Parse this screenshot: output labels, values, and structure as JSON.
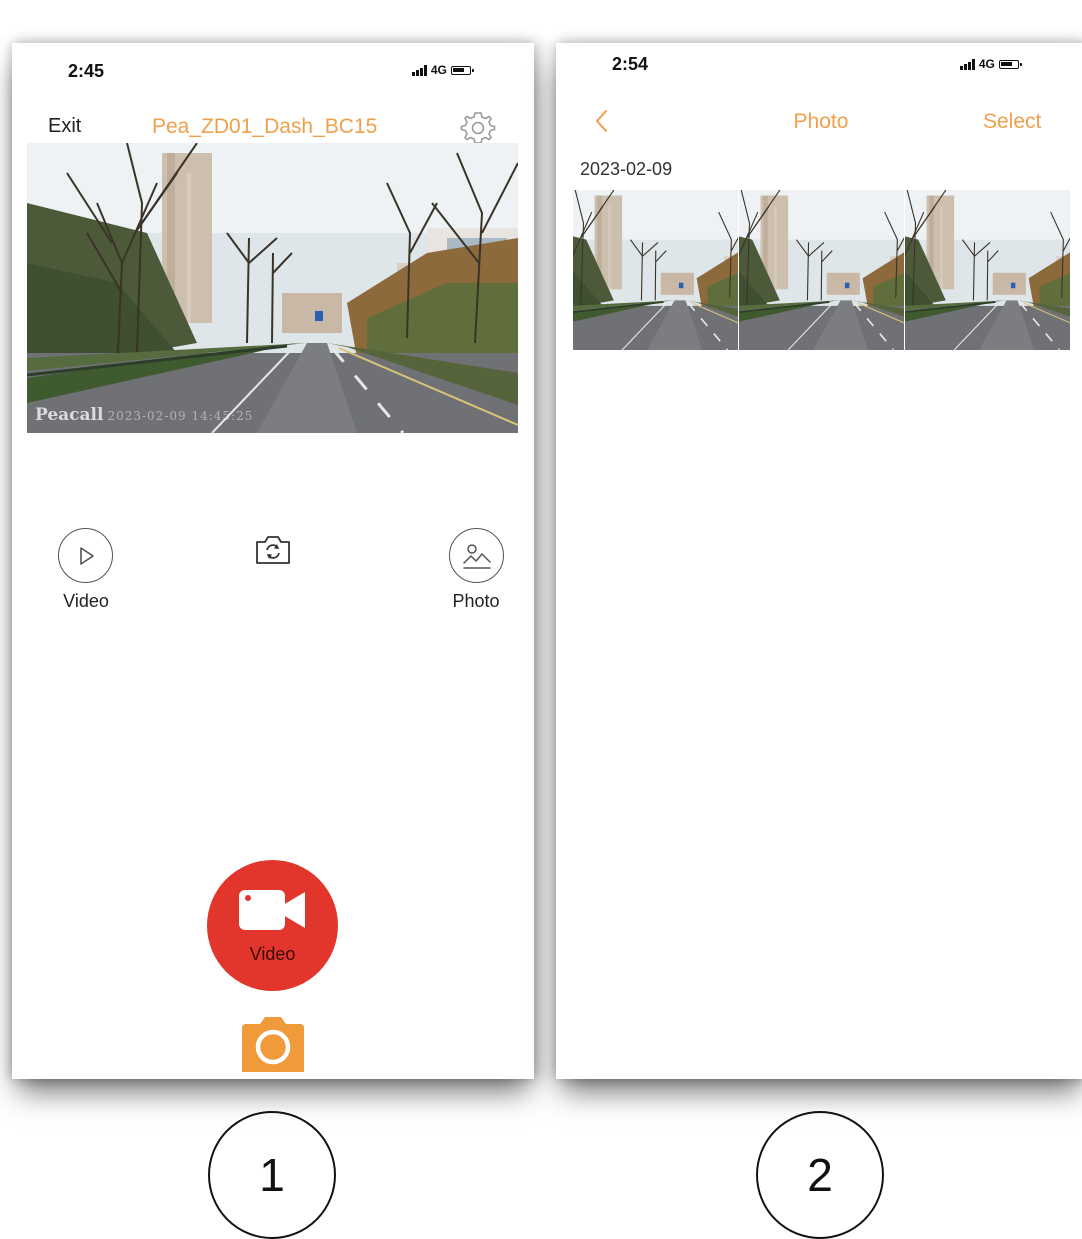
{
  "screen1": {
    "status_time": "2:45",
    "network": "4G",
    "exit_label": "Exit",
    "device_name": "Pea_ZD01_Dash_BC15",
    "watermark_brand": "Peacall",
    "watermark_stamp": "2023-02-09 14:45:25",
    "quick_video_label": "Video",
    "quick_photo_label": "Photo",
    "record_label": "Video",
    "icons": [
      "gear-icon",
      "play-icon",
      "camera-switch-icon",
      "gallery-icon",
      "video-camera-icon",
      "camera-icon"
    ]
  },
  "screen2": {
    "status_time": "2:54",
    "network": "4G",
    "title": "Photo",
    "select_label": "Select",
    "date_header": "2023-02-09",
    "photo_count_visible": 3
  },
  "step_numbers": [
    "1",
    "2"
  ],
  "colors": {
    "accent_orange": "#f0a04b",
    "record_red": "#e2352b",
    "camera_orange": "#f09a3c"
  }
}
